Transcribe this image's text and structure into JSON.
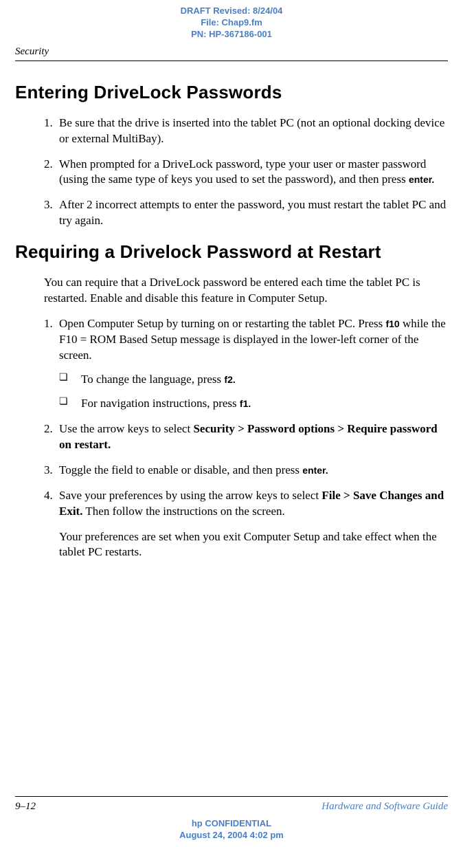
{
  "draft_header": {
    "line1": "DRAFT Revised: 8/24/04",
    "line2": "File: Chap9.fm",
    "line3": "PN: HP-367186-001"
  },
  "section_label": "Security",
  "heading1": "Entering DriveLock Passwords",
  "steps1": [
    {
      "num": "1.",
      "text_before": "Be sure that the drive is inserted into the tablet PC (not an optional docking device or external MultiBay)."
    },
    {
      "num": "2.",
      "text_before": "When prompted for a DriveLock password, type your user or master password (using the same type of keys you used to set the password), and then press ",
      "key": "enter."
    },
    {
      "num": "3.",
      "text_before": "After 2 incorrect attempts to enter the password, you must restart the tablet PC and try again."
    }
  ],
  "heading2": "Requiring a Drivelock Password at Restart",
  "intro2": "You can require that a DriveLock password be entered each time the tablet PC is restarted. Enable and disable this feature in Computer Setup.",
  "steps2": {
    "s1": {
      "num": "1.",
      "text_before": "Open Computer Setup by turning on or restarting the tablet PC. Press ",
      "key1": "f10",
      "text_mid": " while the F10 = ROM Based Setup message is displayed in the lower-left corner of the screen.",
      "sub1_before": "To change the language, press ",
      "sub1_key": "f2.",
      "sub2_before": "For navigation instructions, press ",
      "sub2_key": "f1."
    },
    "s2": {
      "num": "2.",
      "text_before": "Use the arrow keys to select ",
      "path": "Security > Password options > Require password on restart."
    },
    "s3": {
      "num": "3.",
      "text_before": "Toggle the field to enable or disable, and then press ",
      "key": "enter."
    },
    "s4": {
      "num": "4.",
      "text_before": "Save your preferences by using the arrow keys to select ",
      "path": "File > Save Changes and Exit.",
      "text_after": " Then follow the instructions on the screen."
    }
  },
  "note2": "Your preferences are set when you exit Computer Setup and take effect when the tablet PC restarts.",
  "footer": {
    "page": "9–12",
    "guide": "Hardware and Software Guide",
    "conf1": "hp CONFIDENTIAL",
    "conf2": "August 24, 2004 4:02 pm"
  }
}
